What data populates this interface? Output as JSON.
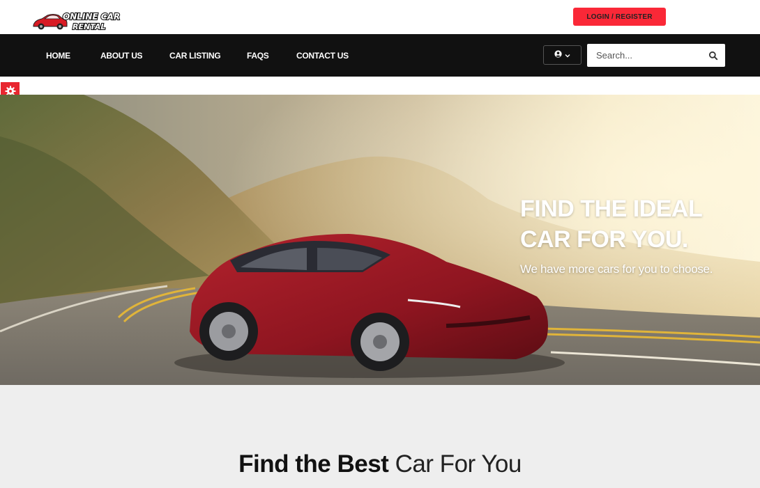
{
  "header": {
    "logo_line1": "ONLINE CAR",
    "logo_line2": "RENTAL",
    "login_label": "LOGIN / REGISTER"
  },
  "nav": {
    "items": [
      {
        "label": "HOME"
      },
      {
        "label": "ABOUT US"
      },
      {
        "label": "CAR LISTING"
      },
      {
        "label": "FAQS"
      },
      {
        "label": "CONTACT US"
      }
    ],
    "user_icon": "user-circle-icon",
    "dropdown_icon": "chevron-down-icon",
    "search": {
      "placeholder": "Search...",
      "icon": "search-icon"
    }
  },
  "settings": {
    "icon": "gear-icon"
  },
  "hero": {
    "title_line1": "FIND THE IDEAL",
    "title_line2": "CAR FOR YOU.",
    "subtitle": "We have more cars for you to choose."
  },
  "section": {
    "heading_bold": "Find the Best",
    "heading_light": "Car For You"
  },
  "colors": {
    "accent": "#fa2837",
    "navbar": "#111111",
    "section_bg": "#eeeeee"
  }
}
